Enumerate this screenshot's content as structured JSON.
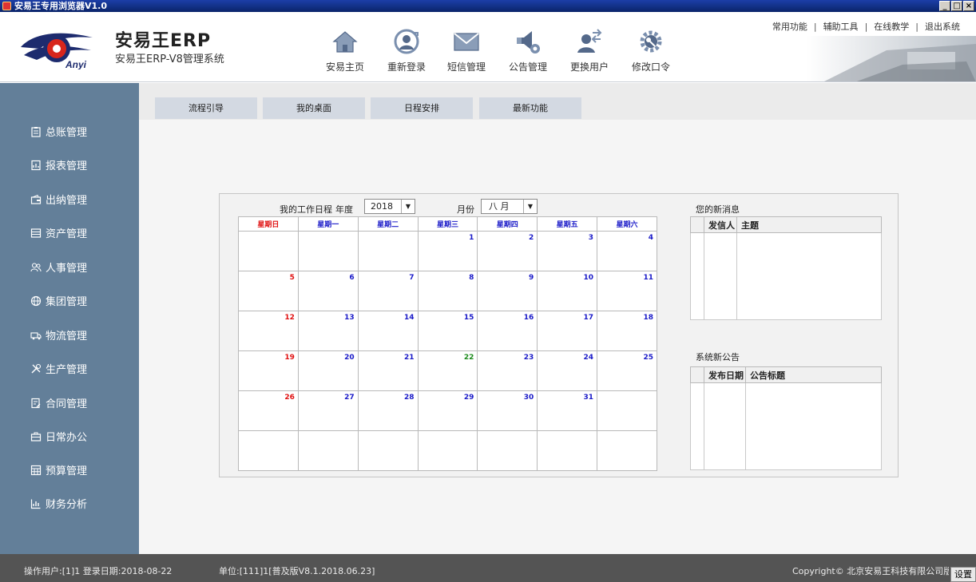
{
  "window": {
    "title": "安易王专用浏览器V1.0",
    "min": "_",
    "max": "□",
    "close": "×"
  },
  "brand": {
    "logo_text": "Anyi",
    "title": "安易王ERP",
    "subtitle": "安易王ERP-V8管理系统"
  },
  "nav": [
    {
      "label": "安易主页",
      "icon": "home-icon"
    },
    {
      "label": "重新登录",
      "icon": "relogin-icon"
    },
    {
      "label": "短信管理",
      "icon": "envelope-icon"
    },
    {
      "label": "公告管理",
      "icon": "announce-icon"
    },
    {
      "label": "更换用户",
      "icon": "switch-user-icon"
    },
    {
      "label": "修改口令",
      "icon": "password-gear-icon"
    }
  ],
  "toplinks": [
    "常用功能",
    "辅助工具",
    "在线教学",
    "退出系统"
  ],
  "sidebar": [
    {
      "label": "总账管理",
      "icon": "clipboard-icon"
    },
    {
      "label": "报表管理",
      "icon": "report-icon"
    },
    {
      "label": "出纳管理",
      "icon": "wallet-icon"
    },
    {
      "label": "资产管理",
      "icon": "asset-icon"
    },
    {
      "label": "人事管理",
      "icon": "people-icon"
    },
    {
      "label": "集团管理",
      "icon": "globe-icon"
    },
    {
      "label": "物流管理",
      "icon": "truck-icon"
    },
    {
      "label": "生产管理",
      "icon": "tools-icon"
    },
    {
      "label": "合同管理",
      "icon": "contract-icon"
    },
    {
      "label": "日常办公",
      "icon": "briefcase-icon"
    },
    {
      "label": "预算管理",
      "icon": "calculator-icon"
    },
    {
      "label": "财务分析",
      "icon": "chart-icon"
    }
  ],
  "tabs": [
    "流程引导",
    "我的桌面",
    "日程安排",
    "最新功能"
  ],
  "schedule": {
    "label": "我的工作日程",
    "year_label": "年度",
    "year": "2018",
    "month_label": "月份",
    "month": "八 月",
    "weekdays": [
      "星期日",
      "星期一",
      "星期二",
      "星期三",
      "星期四",
      "星期五",
      "星期六"
    ],
    "weeks": [
      [
        "",
        "",
        "",
        "1",
        "2",
        "3",
        "4"
      ],
      [
        "5",
        "6",
        "7",
        "8",
        "9",
        "10",
        "11"
      ],
      [
        "12",
        "13",
        "14",
        "15",
        "16",
        "17",
        "18"
      ],
      [
        "19",
        "20",
        "21",
        "22",
        "23",
        "24",
        "25"
      ],
      [
        "26",
        "27",
        "28",
        "29",
        "30",
        "31",
        ""
      ],
      [
        "",
        "",
        "",
        "",
        "",
        "",
        ""
      ]
    ],
    "today": "22"
  },
  "messages": {
    "title": "您的新消息",
    "col_sender": "发信人",
    "col_subject": "主题"
  },
  "announcements": {
    "title": "系统新公告",
    "col_date": "发布日期",
    "col_title": "公告标题"
  },
  "footer": {
    "user": "操作用户:[1]1  登录日期:2018-08-22",
    "unit": "单位:[111]1[普及版V8.1.2018.06.23]",
    "copyright": "Copyright©  北京安易王科技有限公司版权所有",
    "settings": "设置"
  },
  "colors": {
    "sidebar": "#637f99",
    "tab": "#d3d9e2",
    "weekday": "#1a1ac8",
    "sunday": "#e01010",
    "today": "#1a8a1a"
  }
}
